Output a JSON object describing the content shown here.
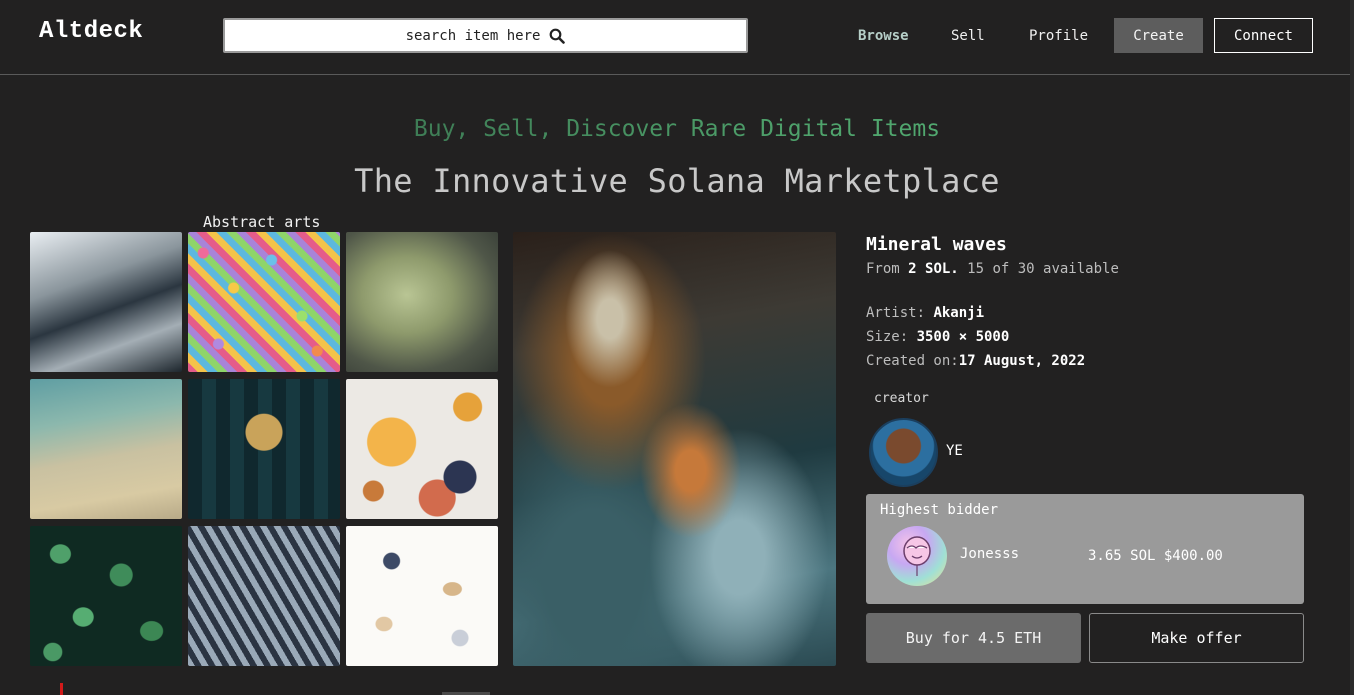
{
  "header": {
    "logo": "Altdeck",
    "search": {
      "value": "search item here"
    },
    "nav": {
      "browse": "Browse",
      "sell": "Sell",
      "profile": "Profile"
    },
    "create_label": "Create",
    "connect_label": "Connect"
  },
  "hero": {
    "tagline": "Buy, Sell, Discover Rare Digital Items",
    "title": "The Innovative Solana Marketplace"
  },
  "gallery": {
    "label": "Abstract arts"
  },
  "item": {
    "name": "Mineral waves",
    "price_prefix": "From ",
    "price": "2 SOL.",
    "availability": " 15 of 30 available",
    "artist_label": "Artist: ",
    "artist": "Akanji",
    "size_label": "Size: ",
    "size": "3500 × 5000",
    "created_label": "Created on:",
    "created": "17 August, 2022",
    "creator_label": "creator",
    "creator_name": "YE"
  },
  "bid": {
    "title": "Highest bidder",
    "user": "Jonesss",
    "amount": "3.65 SOL $400.00"
  },
  "actions": {
    "buy_label": "Buy for 4.5 ETH",
    "offer_label": "Make offer"
  },
  "colors": {
    "background": "#222121",
    "tagline_start": "#2f5a40",
    "tagline_end": "#57b878",
    "bid_card": "#9a9a9a",
    "buy_button": "#6b6b6b"
  }
}
